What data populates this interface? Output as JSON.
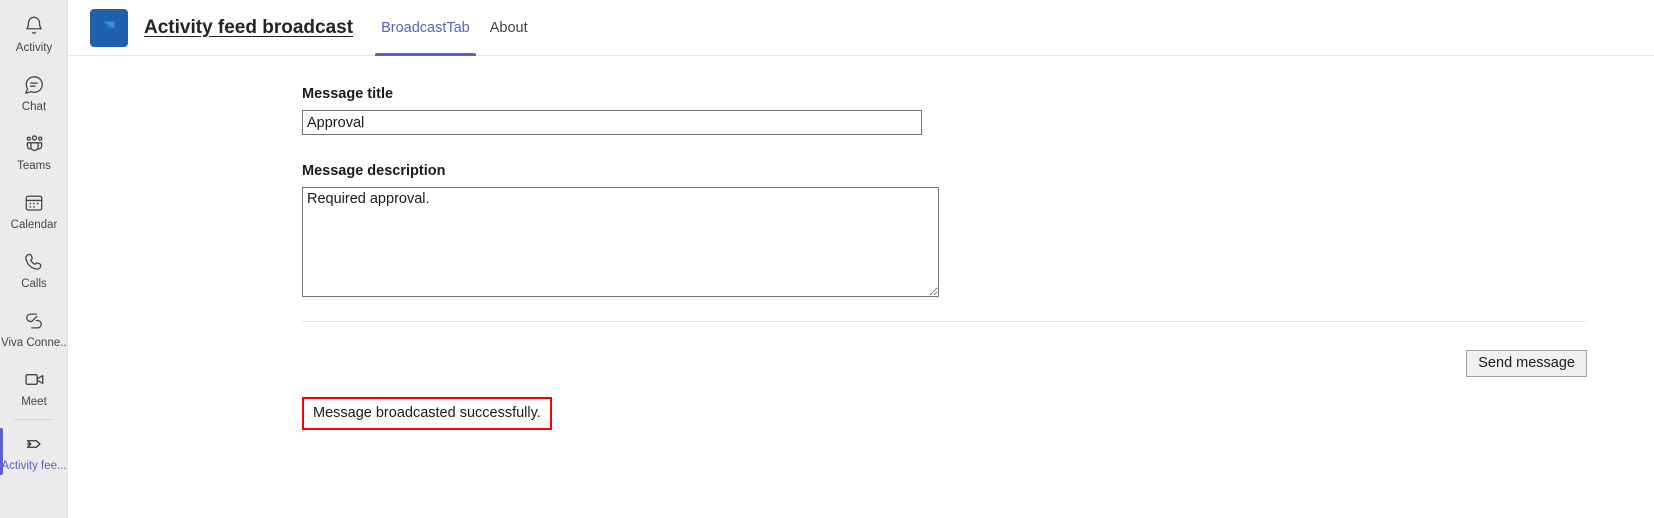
{
  "rail": {
    "items": [
      {
        "label": "Activity",
        "icon": "bell-icon",
        "active": false
      },
      {
        "label": "Chat",
        "icon": "chat-icon",
        "active": false
      },
      {
        "label": "Teams",
        "icon": "teams-icon",
        "active": false
      },
      {
        "label": "Calendar",
        "icon": "calendar-icon",
        "active": false
      },
      {
        "label": "Calls",
        "icon": "phone-icon",
        "active": false
      },
      {
        "label": "Viva Conne...",
        "icon": "viva-connections-icon",
        "active": false
      },
      {
        "label": "Meet",
        "icon": "video-camera-icon",
        "active": false
      },
      {
        "label": "Activity fee...",
        "icon": "broadcast-icon",
        "active": true
      }
    ]
  },
  "appbar": {
    "logo_icon": "app-logo-icon",
    "title": "Activity feed broadcast",
    "tabs": [
      {
        "label": "BroadcastTab",
        "active": true
      },
      {
        "label": "About",
        "active": false
      }
    ]
  },
  "form": {
    "title_label": "Message title",
    "title_value": "Approval",
    "description_label": "Message description",
    "description_value": "Required approval.",
    "send_label": "Send message",
    "status_message": "Message broadcasted successfully."
  },
  "colors": {
    "accent": "#5b5fc7",
    "rail_background": "#ebebeb",
    "logo_background": "#1f61ad",
    "status_border": "#ff0000"
  }
}
